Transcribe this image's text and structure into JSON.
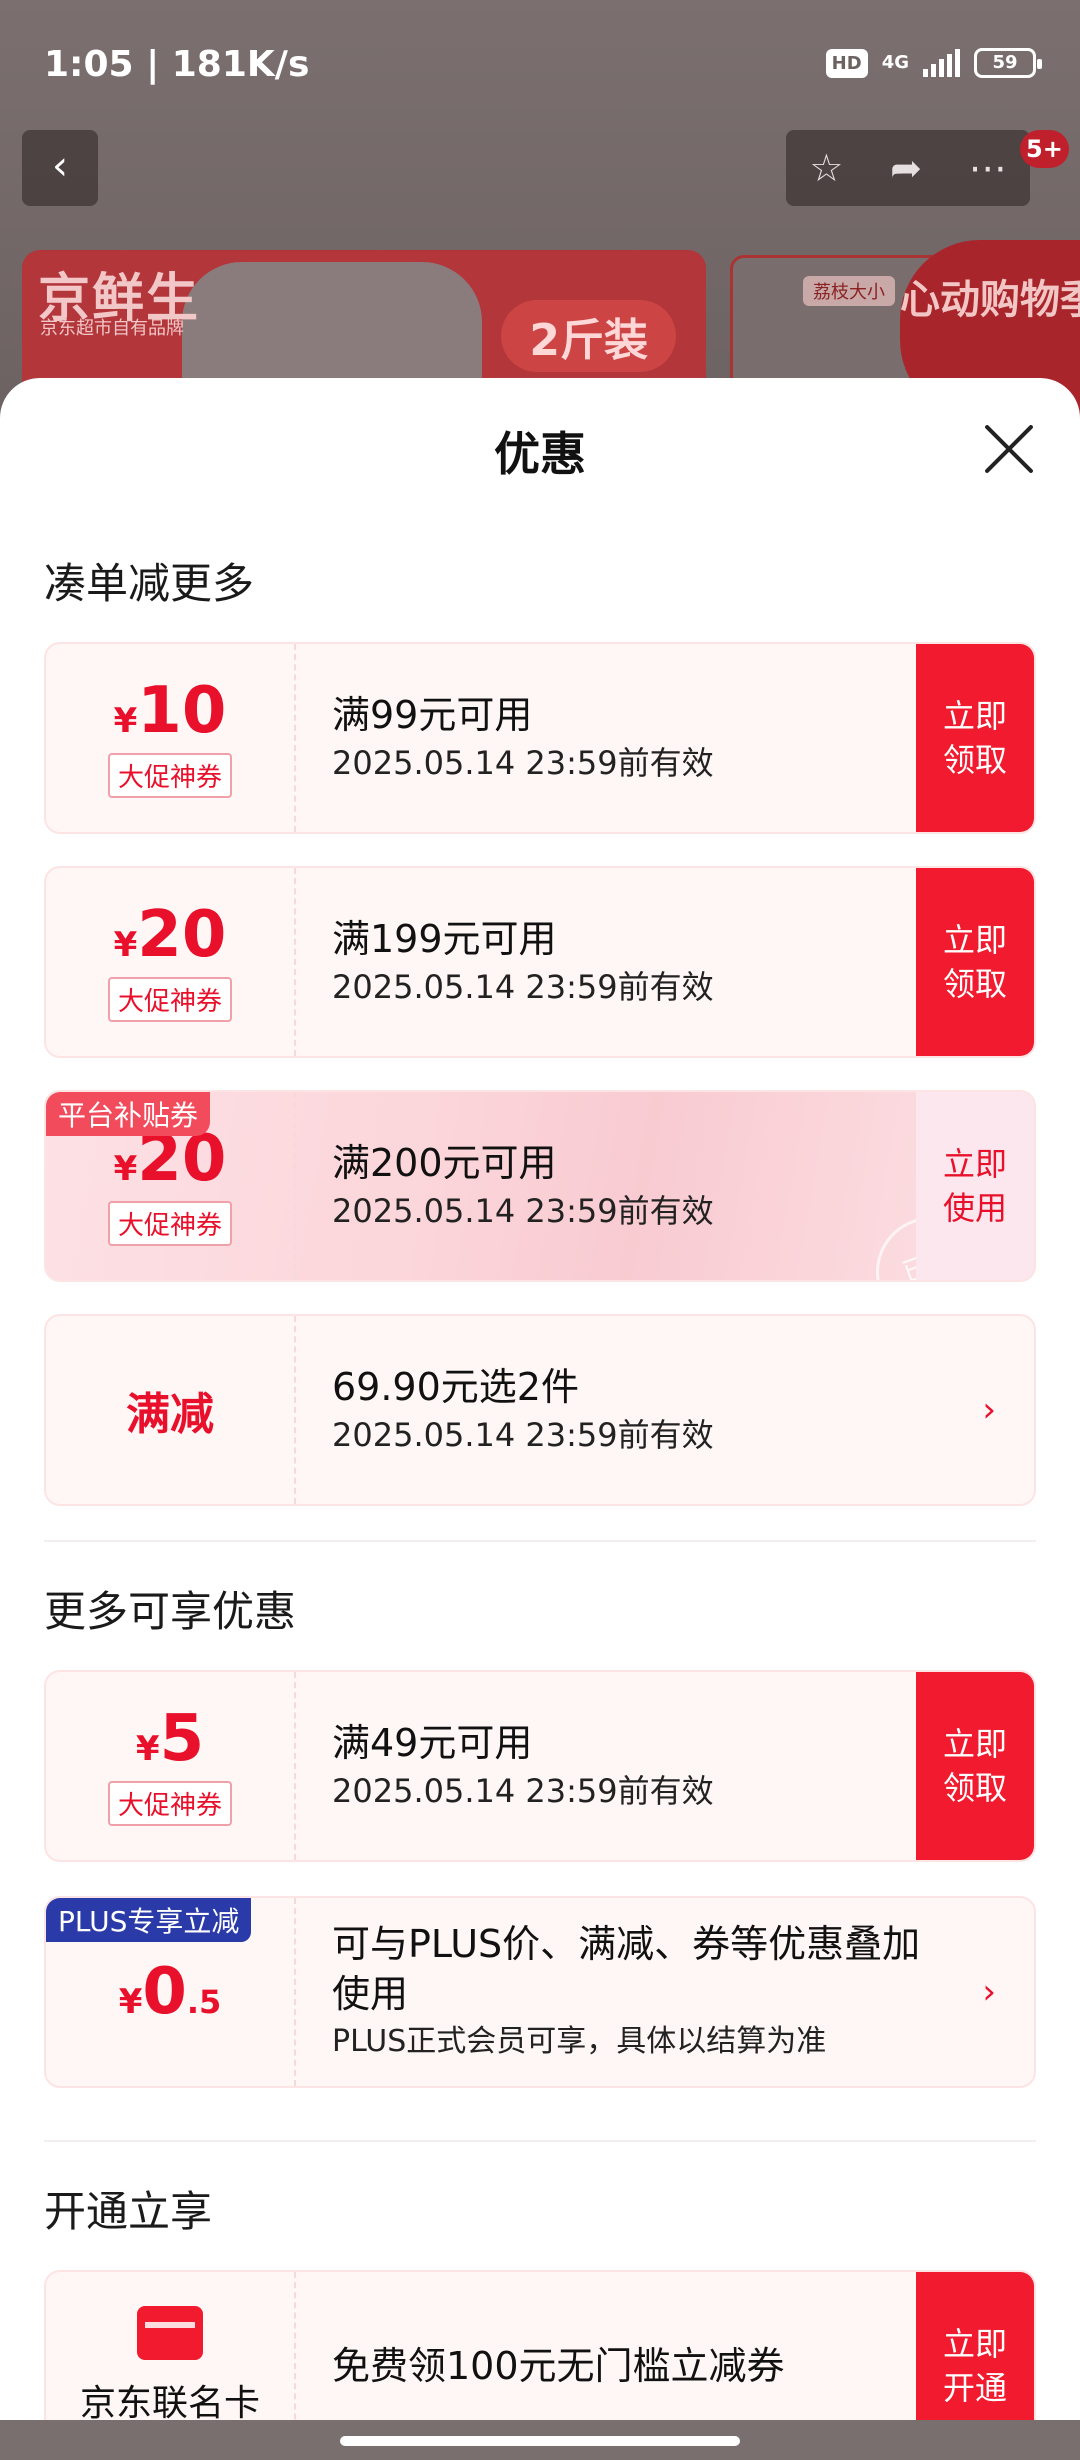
{
  "status_bar": {
    "time": "1:05 | 181K/s",
    "hd": "HD",
    "network": "4G",
    "battery": "59"
  },
  "background": {
    "badge": "5+",
    "brand": "京鲜生",
    "brand_sub": "京东超市自有品牌",
    "pill": "2斤装",
    "right_tag": "荔枝大小",
    "heart_badge": "心动购物季"
  },
  "sheet": {
    "title": "优惠",
    "sections": {
      "s1": "凑单减更多",
      "s2": "更多可享优惠",
      "s3": "开通立享"
    },
    "coupons": [
      {
        "yen": "¥",
        "amount": "10",
        "tag": "大促神券",
        "line1": "满99元可用",
        "line2": "2025.05.14 23:59前有效",
        "action": "立即领取"
      },
      {
        "yen": "¥",
        "amount": "20",
        "tag": "大促神券",
        "line1": "满199元可用",
        "line2": "2025.05.14 23:59前有效",
        "action": "立即领取"
      },
      {
        "corner": "平台补贴券",
        "yen": "¥",
        "amount": "20",
        "tag": "大促神券",
        "line1": "满200元可用",
        "line2": "2025.05.14 23:59前有效",
        "action": "立即使用",
        "stamp": "已领"
      },
      {
        "label": "满减",
        "line1": "69.90元选2件",
        "line2": "2025.05.14 23:59前有效",
        "chevron": "›"
      },
      {
        "yen": "¥",
        "amount": "5",
        "tag": "大促神券",
        "line1": "满49元可用",
        "line2": "2025.05.14 23:59前有效",
        "action": "立即领取"
      },
      {
        "corner": "PLUS专享立减",
        "yen": "¥",
        "amount": "0",
        "decimal": ".5",
        "line1": "可与PLUS价、满减、券等优惠叠加使用",
        "line2": "PLUS正式会员可享，具体以结算为准",
        "chevron": "›"
      },
      {
        "card_name": "京东联名卡",
        "line1": "免费领100元无门槛立减券",
        "action": "立即开通"
      }
    ]
  }
}
